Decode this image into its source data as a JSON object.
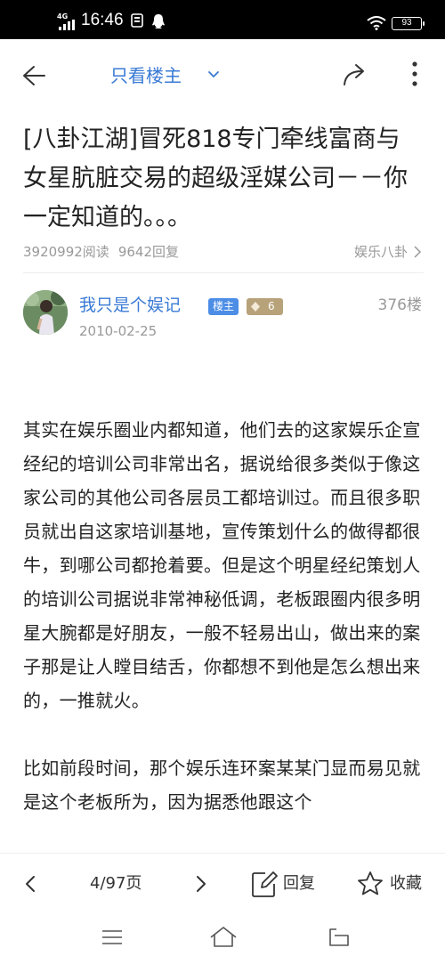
{
  "status_bar": {
    "network": "4G",
    "time": "16:46",
    "battery": "93"
  },
  "nav": {
    "title": "只看楼主",
    "icons": [
      "back-arrow-icon",
      "chevron-down-icon",
      "share-icon",
      "more-vertical-icon"
    ]
  },
  "post": {
    "title": "[八卦江湖]冒死818专门牵线富商与女星肮脏交易的超级淫媒公司－－你一定知道的。。。",
    "reads": "3920992阅读",
    "replies": "9642回复",
    "category": "娱乐八卦"
  },
  "author": {
    "name": "我只是个娱记",
    "owner_badge": "楼主",
    "level": "6",
    "floor": "376楼",
    "date": "2010-02-25"
  },
  "content": {
    "paragraph1": "其实在娱乐圈业内都知道，他们去的这家娱乐企宣经纪的培训公司非常出名，据说给很多类似于像这家公司的其他公司各层员工都培训过。而且很多职员就出自这家培训基地，宣传策划什么的做得都很牛，到哪公司都抢着要。但是这个明星经纪策划人的培训公司据说非常神秘低调，老板跟圈内很多明星大腕都是好朋友，一般不轻易出山，做出来的案子那是让人瞠目结舌，你都想不到他是怎么想出来的，一推就火。",
    "paragraph2": "比如前段时间，那个娱乐连环案某某门显而易见就是这个老板所为，因为据悉他跟这个"
  },
  "toolbar": {
    "page_indicator": "4/97页",
    "reply_label": "回复",
    "favorite_label": "收藏"
  },
  "colors": {
    "accent": "#3a7bd5",
    "owner_badge": "#4c8de6",
    "level_badge": "#b8a27a",
    "meta_text": "#999999"
  }
}
